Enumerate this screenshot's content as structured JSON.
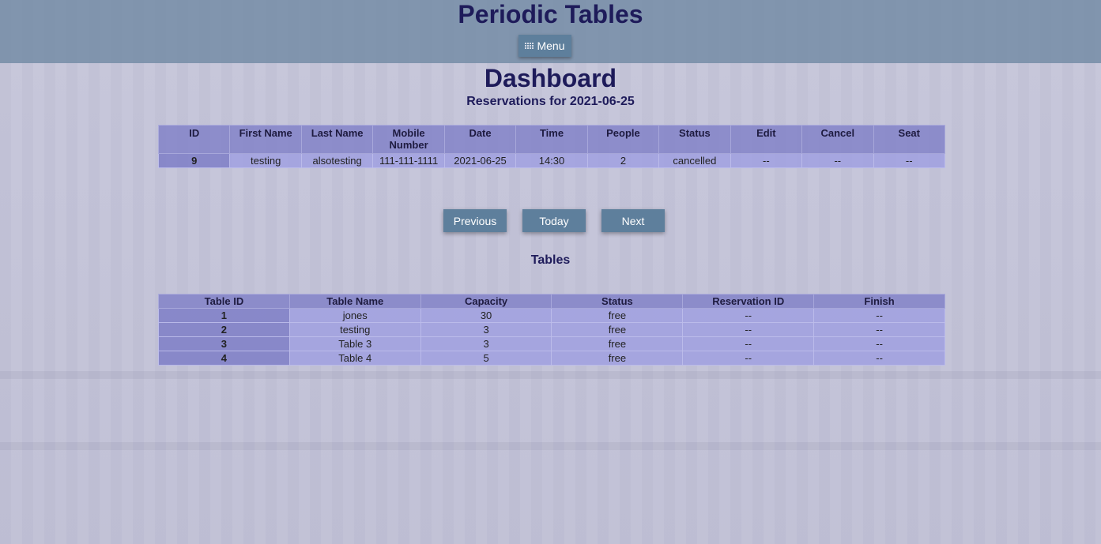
{
  "header": {
    "site_title": "Periodic Tables",
    "menu_label": "Menu",
    "menu_icon": "grid-icon"
  },
  "dashboard": {
    "title": "Dashboard",
    "subtitle": "Reservations for 2021-06-25"
  },
  "reservations": {
    "columns": [
      "ID",
      "First Name",
      "Last Name",
      "Mobile Number",
      "Date",
      "Time",
      "People",
      "Status",
      "Edit",
      "Cancel",
      "Seat"
    ],
    "rows": [
      [
        "9",
        "testing",
        "alsotesting",
        "111-111-1111",
        "2021-06-25",
        "14:30",
        "2",
        "cancelled",
        "--",
        "--",
        "--"
      ]
    ]
  },
  "date_nav": {
    "previous": "Previous",
    "today": "Today",
    "next": "Next"
  },
  "tables": {
    "heading": "Tables",
    "columns": [
      "Table ID",
      "Table Name",
      "Capacity",
      "Status",
      "Reservation ID",
      "Finish"
    ],
    "rows": [
      [
        "1",
        "jones",
        "30",
        "free",
        "--",
        "--"
      ],
      [
        "2",
        "testing",
        "3",
        "free",
        "--",
        "--"
      ],
      [
        "3",
        "Table 3",
        "3",
        "free",
        "--",
        "--"
      ],
      [
        "4",
        "Table 4",
        "5",
        "free",
        "--",
        "--"
      ]
    ]
  },
  "colors": {
    "header_bg": "#748ca6",
    "button_bg": "#5e7f9c",
    "title_text": "#1e1b5a"
  }
}
